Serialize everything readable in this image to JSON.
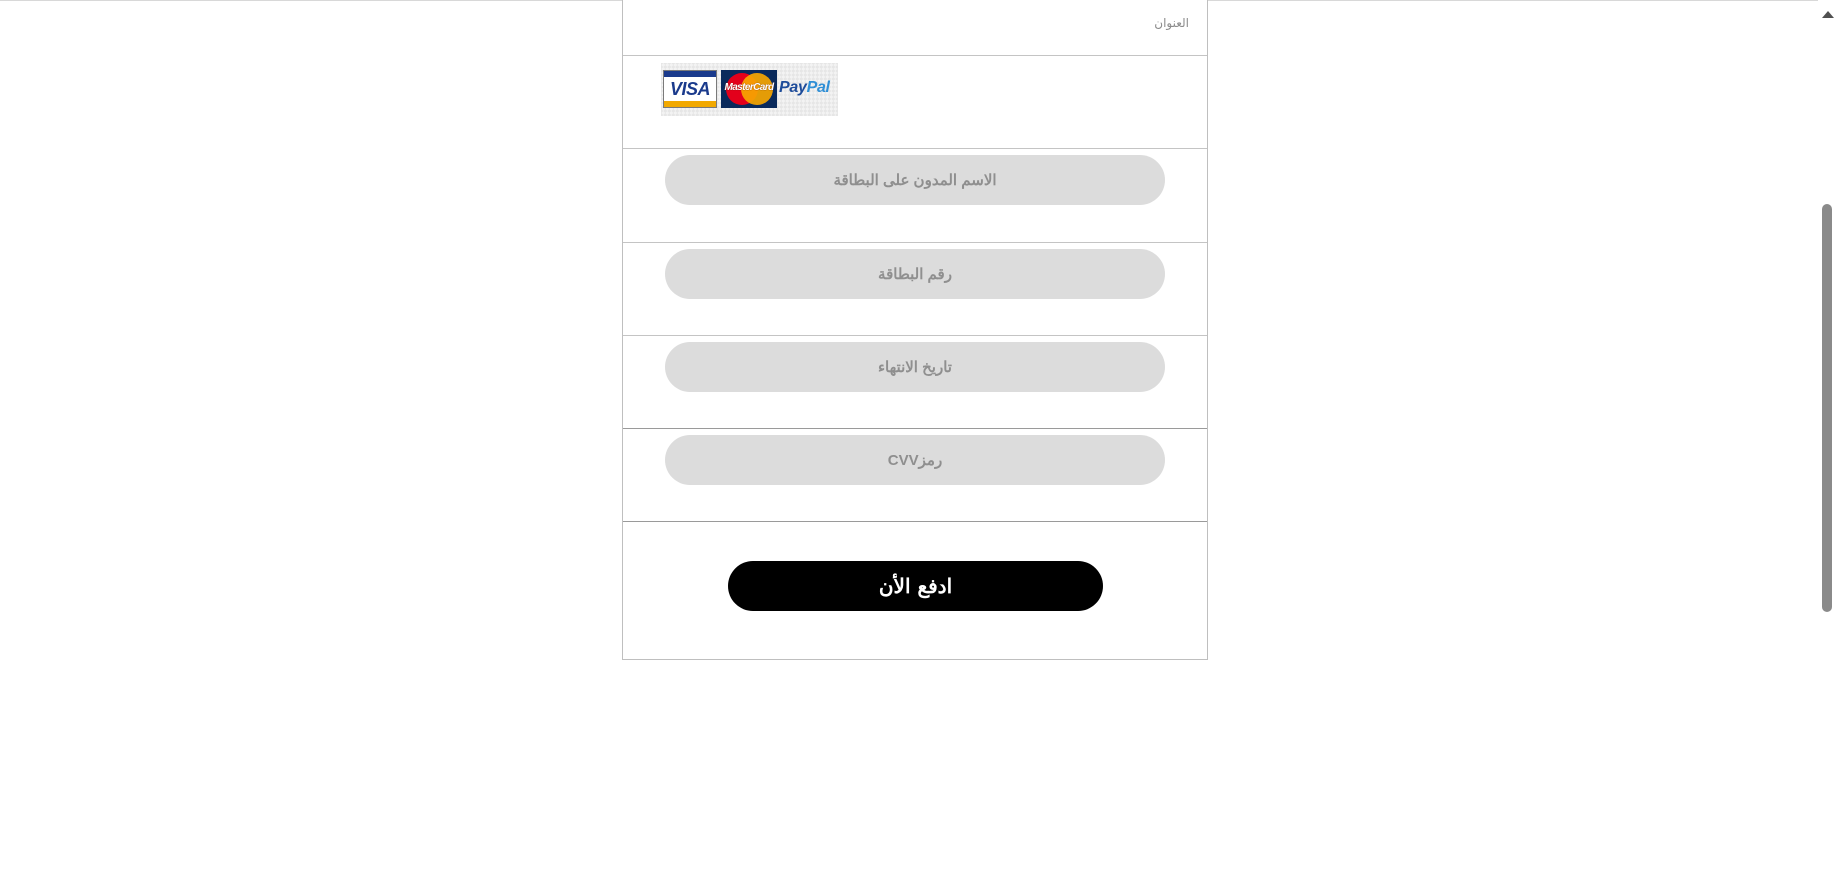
{
  "address": {
    "label": "العنوان"
  },
  "payment_logos": {
    "visa": "VISA",
    "mastercard": "MasterCard",
    "paypal_pay": "Pay",
    "paypal_pal": "Pal"
  },
  "fields": {
    "cardholder_name": {
      "placeholder": "الاسم المدون على البطاقة",
      "value": ""
    },
    "card_number": {
      "placeholder": "رقم البطاقة",
      "value": ""
    },
    "expiry_date": {
      "placeholder": "تاريخ الانتهاء",
      "value": ""
    },
    "cvv": {
      "placeholder": "رمزCVV",
      "value": ""
    }
  },
  "submit": {
    "label": "ادفع الأن"
  },
  "colors": {
    "input_bg": "#dcdcdc",
    "placeholder_text": "#8f8f8f",
    "button_bg": "#000000",
    "button_text": "#ffffff"
  },
  "icons": {
    "scroll_up": "triangle-up"
  }
}
